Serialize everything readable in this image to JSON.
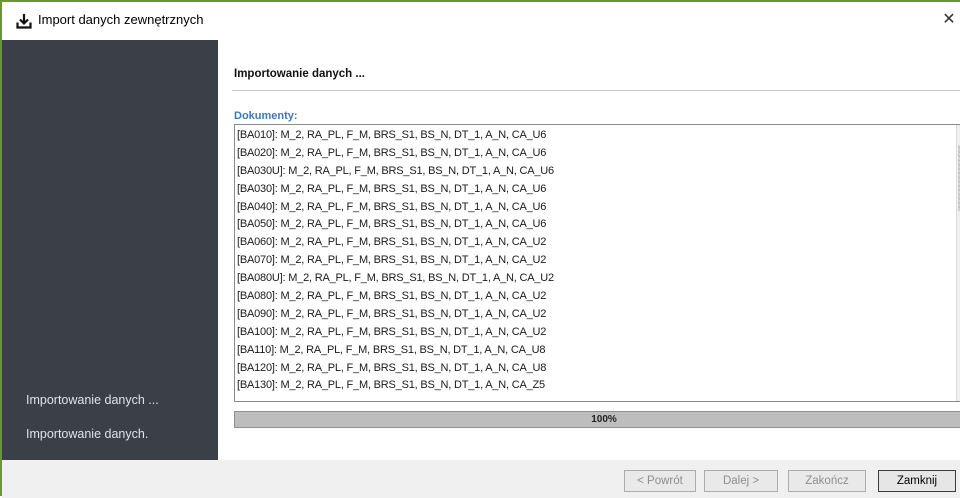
{
  "window": {
    "title": "Import danych zewnętrznych",
    "icon": "download-icon",
    "close_label": "✕"
  },
  "sidebar": {
    "steps": [
      {
        "label": "Importowanie danych ..."
      },
      {
        "label": "Importowanie danych."
      }
    ]
  },
  "main": {
    "title": "Importowanie danych ...",
    "documents_label": "Dokumenty:",
    "documents": [
      "[BA010]: M_2, RA_PL, F_M, BRS_S1, BS_N, DT_1, A_N, CA_U6",
      "[BA020]: M_2, RA_PL, F_M, BRS_S1, BS_N, DT_1, A_N, CA_U6",
      "[BA030U]: M_2, RA_PL, F_M, BRS_S1, BS_N, DT_1, A_N, CA_U6",
      "[BA030]: M_2, RA_PL, F_M, BRS_S1, BS_N, DT_1, A_N, CA_U6",
      "[BA040]: M_2, RA_PL, F_M, BRS_S1, BS_N, DT_1, A_N, CA_U6",
      "[BA050]: M_2, RA_PL, F_M, BRS_S1, BS_N, DT_1, A_N, CA_U6",
      "[BA060]: M_2, RA_PL, F_M, BRS_S1, BS_N, DT_1, A_N, CA_U2",
      "[BA070]: M_2, RA_PL, F_M, BRS_S1, BS_N, DT_1, A_N, CA_U2",
      "[BA080U]: M_2, RA_PL, F_M, BRS_S1, BS_N, DT_1, A_N, CA_U2",
      "[BA080]: M_2, RA_PL, F_M, BRS_S1, BS_N, DT_1, A_N, CA_U2",
      "[BA090]: M_2, RA_PL, F_M, BRS_S1, BS_N, DT_1, A_N, CA_U2",
      "[BA100]: M_2, RA_PL, F_M, BRS_S1, BS_N, DT_1, A_N, CA_U2",
      "[BA110]: M_2, RA_PL, F_M, BRS_S1, BS_N, DT_1, A_N, CA_U8",
      "[BA120]: M_2, RA_PL, F_M, BRS_S1, BS_N, DT_1, A_N, CA_U8",
      "[BA130]: M_2, RA_PL, F_M, BRS_S1, BS_N, DT_1, A_N, CA_Z5"
    ],
    "progress": {
      "value": 100,
      "label": "100%"
    }
  },
  "footer": {
    "back_label": "< Powrót",
    "next_label": "Dalej >",
    "finish_label": "Zakończ",
    "close_label": "Zamknij"
  },
  "colors": {
    "accent_border": "#6a9a1f",
    "sidebar_bg": "#3b3f48",
    "documents_label": "#3a78c0"
  }
}
